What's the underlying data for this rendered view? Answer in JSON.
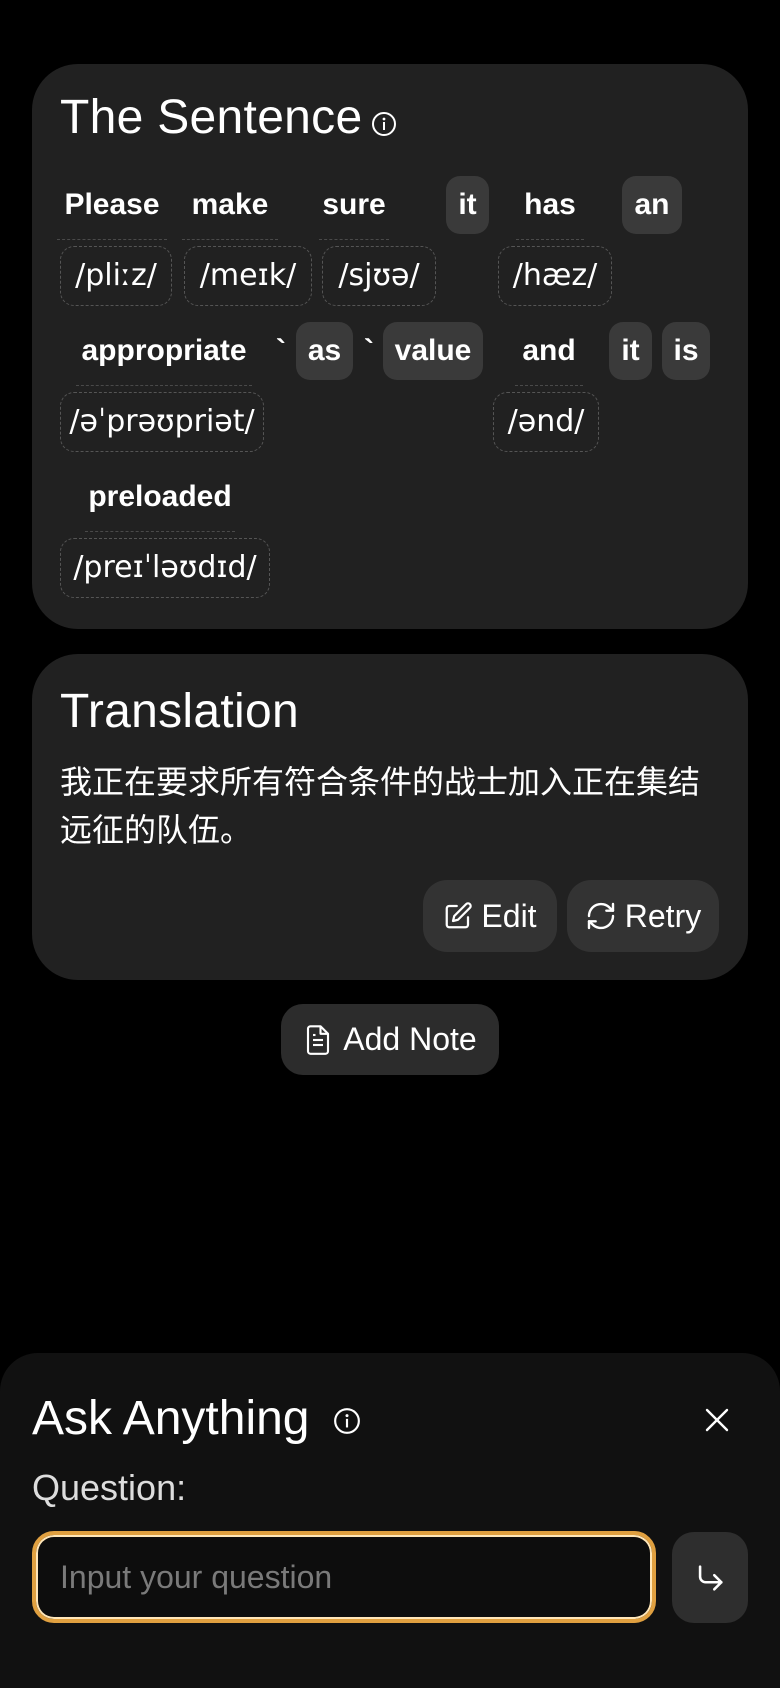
{
  "sentence": {
    "title": "The Sentence",
    "words": [
      {
        "text": "Please",
        "highlight": false
      },
      {
        "text": "make",
        "highlight": false
      },
      {
        "text": "sure",
        "highlight": false
      },
      {
        "text": "it",
        "highlight": true
      },
      {
        "text": "has",
        "highlight": false
      },
      {
        "text": "an",
        "highlight": true
      },
      {
        "text": "appropriate",
        "highlight": false
      },
      {
        "text": "`",
        "highlight": false
      },
      {
        "text": "as",
        "highlight": true
      },
      {
        "text": "`",
        "highlight": false
      },
      {
        "text": "value",
        "highlight": true
      },
      {
        "text": "and",
        "highlight": false
      },
      {
        "text": "it",
        "highlight": true
      },
      {
        "text": "is",
        "highlight": true
      },
      {
        "text": "preloaded",
        "highlight": false
      }
    ],
    "phonetics": [
      "/pliːz/",
      "/meɪk/",
      "/sjʊə/",
      "/hæz/",
      "/əˈprəʊpriət/",
      "/ənd/",
      "/preɪˈləʊdɪd/"
    ]
  },
  "translation": {
    "title": "Translation",
    "text": "我正在要求所有符合条件的战士加入正在集结远征的队伍。",
    "edit_label": "Edit",
    "retry_label": "Retry"
  },
  "add_note_label": "Add Note",
  "ask": {
    "title": "Ask Anything",
    "question_label": "Question:",
    "input_placeholder": "Input your question",
    "input_value": ""
  },
  "colors": {
    "background": "#000000",
    "card": "#212121",
    "highlight_chip": "#3a3a3a",
    "input_border": "#e0a040"
  }
}
